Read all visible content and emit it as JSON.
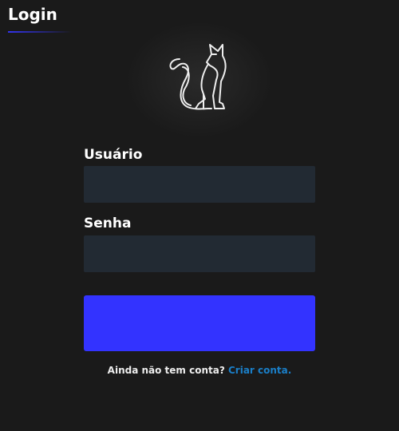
{
  "header": {
    "title": "Login"
  },
  "logo": {
    "icon": "cat-icon"
  },
  "form": {
    "username_label": "Usuário",
    "username_value": "",
    "password_label": "Senha",
    "password_value": "",
    "submit_label": "",
    "signup_prompt": "Ainda não tem conta?",
    "signup_link": "Criar conta."
  },
  "colors": {
    "accent": "#3333ff",
    "link": "#1a7fc8",
    "input_bg": "#222a33",
    "background": "#1a1a1a"
  }
}
